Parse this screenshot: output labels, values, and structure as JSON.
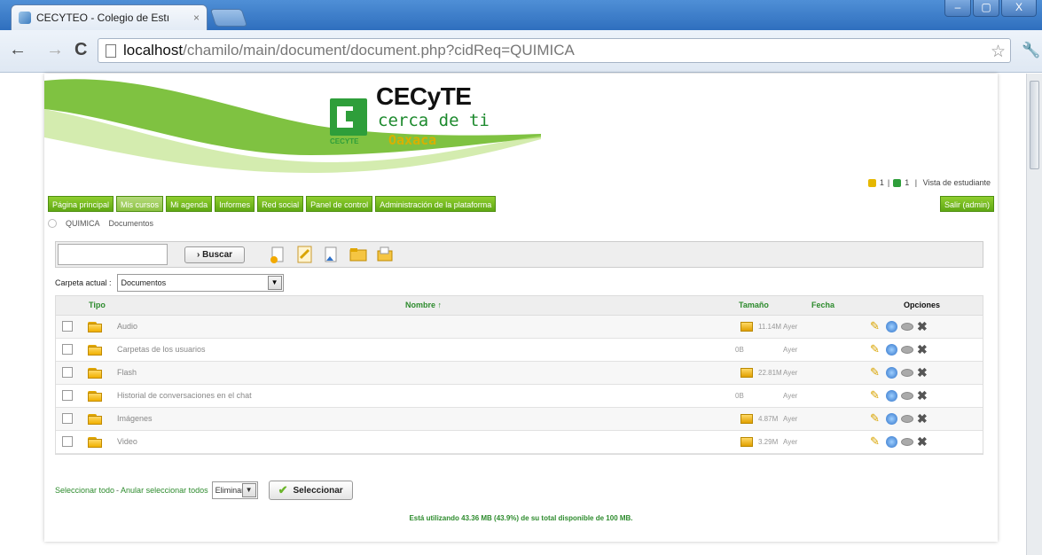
{
  "browser": {
    "tab_title": "CECYTEO - Colegio de Estı",
    "tab_close": "×",
    "url_host": "localhost",
    "url_path": "/chamilo/main/document/document.php?cidReq=QUIMICA",
    "window_buttons": [
      "–",
      "▢",
      "X"
    ]
  },
  "logo": {
    "main": "CECyTE",
    "sub": "cerca de ti",
    "state": "Oaxaca",
    "small": "CECYTE"
  },
  "userinfo": {
    "count1": "1",
    "count2": "1",
    "link": "Vista de estudiante"
  },
  "nav": {
    "items": [
      "Página principal",
      "Mis cursos",
      "Mi agenda",
      "Informes",
      "Red social",
      "Panel de control",
      "Administración de la plataforma"
    ],
    "active_index": 1,
    "logout": "Salir (admin)"
  },
  "breadcrumb": [
    "QUIMICA",
    "Documentos"
  ],
  "tools": {
    "search_value": "",
    "search_button": "Buscar",
    "buscar_prefix": "›"
  },
  "current_folder": {
    "label": "Carpeta actual :",
    "value": "Documentos"
  },
  "table": {
    "headers": {
      "tipo": "Tipo",
      "nombre": "Nombre ↑",
      "tamano": "Tamaño",
      "fecha": "Fecha",
      "opciones": "Opciones"
    },
    "rows": [
      {
        "name": "Audio",
        "size": "11.14M",
        "date": "Ayer",
        "has_size_icon": true
      },
      {
        "name": "Carpetas de los usuarios",
        "size": "0B",
        "date": "Ayer",
        "has_size_icon": false
      },
      {
        "name": "Flash",
        "size": "22.81M",
        "date": "Ayer",
        "has_size_icon": true
      },
      {
        "name": "Historial de conversaciones en el chat",
        "size": "0B",
        "date": "Ayer",
        "has_size_icon": false
      },
      {
        "name": "Imágenes",
        "size": "4.87M",
        "date": "Ayer",
        "has_size_icon": true
      },
      {
        "name": "Video",
        "size": "3.29M",
        "date": "Ayer",
        "has_size_icon": true
      }
    ]
  },
  "bulk": {
    "select_all": "Seleccionar todo",
    "separator": "-",
    "deselect_all": "Anular seleccionar todos",
    "action_value": "Eliminar",
    "submit": "Seleccionar"
  },
  "quota_text": "Está utilizando 43.36 MB (43.9%) de su total disponible de 100 MB.",
  "colors": {
    "nav_green": "#5fa814",
    "link_green": "#2d8b2d",
    "titlebar_blue": "#2f6fbe"
  }
}
